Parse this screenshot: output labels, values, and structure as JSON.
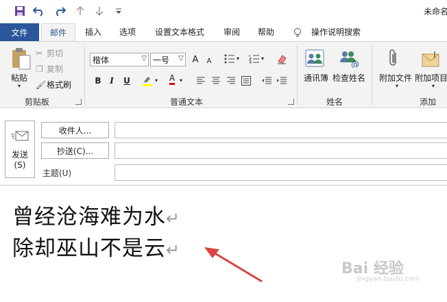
{
  "window": {
    "title": "未命名"
  },
  "quick_access": {
    "icons": [
      "save-icon",
      "undo-icon",
      "redo-icon",
      "up-arrow-icon",
      "down-arrow-icon",
      "customize-qat-icon"
    ]
  },
  "tabs": [
    {
      "label": "文件"
    },
    {
      "label": "邮件"
    },
    {
      "label": "插入"
    },
    {
      "label": "选项"
    },
    {
      "label": "设置文本格式"
    },
    {
      "label": "审阅"
    },
    {
      "label": "帮助"
    },
    {
      "label": "操作说明搜索"
    }
  ],
  "clipboard": {
    "paste": "粘贴",
    "cut": "剪切",
    "copy": "复制",
    "format_painter": "格式刷",
    "group": "剪贴板"
  },
  "basic_text": {
    "font": "楷体",
    "size": "一号",
    "bold": "B",
    "italic": "I",
    "underline": "U",
    "font_color": "A",
    "grow": "A",
    "shrink": "A",
    "group": "普通文本"
  },
  "names": {
    "address_book": "通讯簿",
    "check_names": "检查姓名",
    "group": "姓名"
  },
  "include": {
    "attach_file": "附加文件",
    "attach_item": "附加项目",
    "group": "添加"
  },
  "compose": {
    "send": "发送",
    "send_key": "(S)",
    "to": "收件人...",
    "cc": "抄送(C)...",
    "subject_label": "主题(U)"
  },
  "body": {
    "line1": "曾经沧海难为水",
    "line2": "除却巫山不是云",
    "para_mark": "↵"
  },
  "watermark": {
    "brand": "Bai 经验",
    "url": "jingyan.baidu.com"
  },
  "colors": {
    "accent": "#2b579a",
    "ribbon_bg": "#f3f3f3",
    "arrow": "#d9433f"
  }
}
